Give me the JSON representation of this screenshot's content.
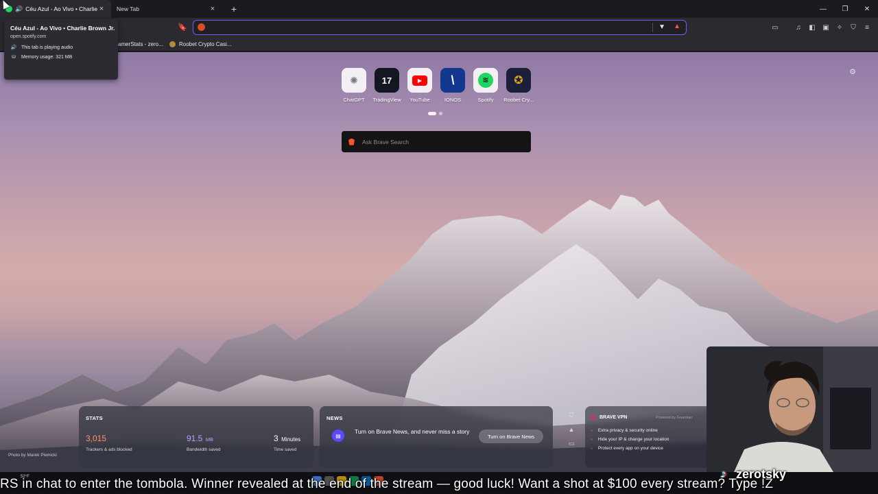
{
  "tabs": [
    {
      "title": "Céu Azul - Ao Vivo • Charlie B",
      "active": true,
      "playing": true
    },
    {
      "title": "New Tab",
      "active": false,
      "playing": false
    }
  ],
  "toolbar": {
    "address_value": "",
    "address_placeholder": ""
  },
  "bookmarks": [
    {
      "label": "amerStats - zero..."
    },
    {
      "label": "Roobet Crypto Casi..."
    }
  ],
  "tooltip": {
    "title": "Céu Azul - Ao Vivo • Charlie Brown Jr.",
    "url": "open.spotify.com",
    "audio": "This tab is playing audio",
    "memory": "Memory usage: 321 MB"
  },
  "top_sites": [
    {
      "label": "ChatGPT",
      "icon": "chatgpt-icon",
      "glyph": "✺",
      "color": "#888888"
    },
    {
      "label": "TradingView",
      "icon": "tradingview-icon",
      "glyph": "17",
      "color": "#131722"
    },
    {
      "label": "YouTube",
      "icon": "youtube-icon",
      "glyph": "▶",
      "color": "#ff0000"
    },
    {
      "label": "IONOS",
      "icon": "ionos-icon",
      "glyph": "\\",
      "color": "#11388c"
    },
    {
      "label": "Spotify",
      "icon": "spotify-icon",
      "glyph": "≋",
      "color": "#1ed760"
    },
    {
      "label": "Roobet Cry...",
      "icon": "roobet-icon",
      "glyph": "✪",
      "color": "#d9a520"
    }
  ],
  "search": {
    "placeholder": "Ask Brave Search"
  },
  "stats": {
    "heading": "STATS",
    "trackers_value": "3,015",
    "trackers_label": "Trackers & ads blocked",
    "bandwidth_value": "91.5",
    "bandwidth_unit": "MB",
    "bandwidth_label": "Bandwidth saved",
    "time_value": "3",
    "time_unit": "Minutes",
    "time_label": "Time saved"
  },
  "news": {
    "heading": "NEWS",
    "text": "Turn on Brave News, and never miss a story",
    "button": "Turn on Brave News"
  },
  "vpn": {
    "heading": "BRAVE VPN",
    "powered": "Powered by Guardian",
    "features": [
      "Extra privacy & security online",
      "Hide your IP & change your location",
      "Protect every app on your device"
    ]
  },
  "photo_credit": "Photo by Marek Piwnicki",
  "weather": "52°F",
  "overlay": {
    "ticker": "RS in chat to enter the tombola. Winner revealed at the end of the stream — good luck!  Want a shot at $100 every stream? Type !Z",
    "handle": "zerotsky"
  },
  "colors": {
    "accent": "#6f5cff",
    "brave_orange": "#fb542b",
    "trackers_color": "#ff8f6b",
    "bandwidth_color": "#b9a3ff"
  }
}
